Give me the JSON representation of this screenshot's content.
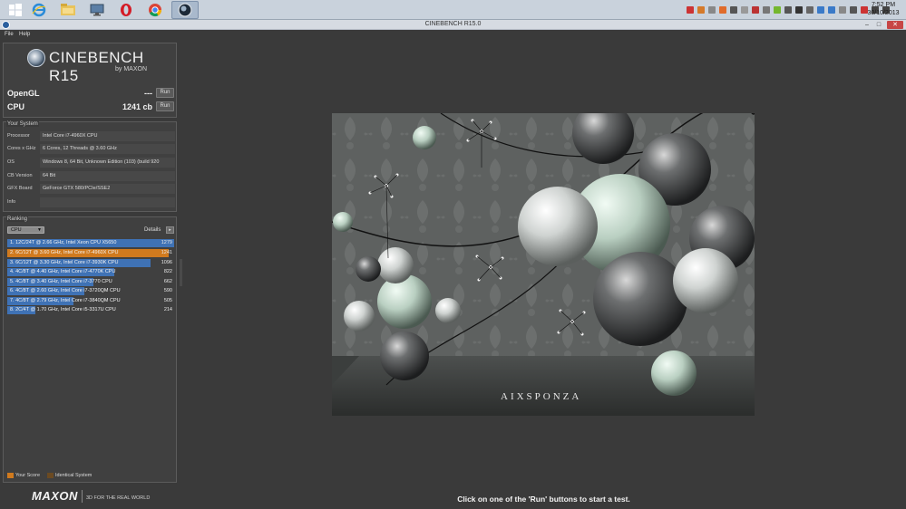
{
  "taskbar": {
    "items": [
      {
        "icon": "windows-start-icon"
      },
      {
        "icon": "internet-explorer-icon"
      },
      {
        "icon": "file-explorer-icon"
      },
      {
        "icon": "computer-icon"
      },
      {
        "icon": "opera-icon"
      },
      {
        "icon": "chrome-icon"
      },
      {
        "icon": "cinebench-icon",
        "active": true
      }
    ],
    "clock_time": "7:52 PM",
    "clock_date": "30/10/2013"
  },
  "window": {
    "title": "CINEBENCH R15.0",
    "minimize": "–",
    "maximize": "□",
    "close": "✕"
  },
  "menu": {
    "items": [
      "File",
      "Help"
    ]
  },
  "header": {
    "logo_text": "CINEBENCH R15",
    "logo_by": "by MAXON"
  },
  "benchmarks": {
    "opengl": {
      "label": "OpenGL",
      "score": "---",
      "run_label": "Run"
    },
    "cpu": {
      "label": "CPU",
      "score": "1241 cb",
      "run_label": "Run"
    }
  },
  "system": {
    "title": "Your System",
    "rows": [
      {
        "label": "Processor",
        "value": "Intel Core i7-4960X CPU"
      },
      {
        "label": "Cores x GHz",
        "value": "6 Cores, 12 Threads @ 3.60 GHz"
      },
      {
        "label": "OS",
        "value": "Windows 8, 64 Bit, Unknown Edition (103) (build 920"
      },
      {
        "label": "CB Version",
        "value": "64 Bit"
      },
      {
        "label": "GFX Board",
        "value": "GeForce GTX 580/PCIe/SSE2"
      },
      {
        "label": "Info",
        "value": ""
      }
    ]
  },
  "ranking": {
    "title": "Ranking",
    "dropdown_value": "CPU",
    "details_label": "Details",
    "details_button": "▸",
    "rows": [
      {
        "text": "1. 12C/24T @ 2.66 GHz, Intel Xeon CPU X5650",
        "score": "1279",
        "fraction": 1.0,
        "highlight": false
      },
      {
        "text": "2. 6C/12T @ 3.60 GHz,  Intel Core i7-4960X CPU",
        "score": "1241",
        "fraction": 0.97,
        "highlight": true
      },
      {
        "text": "3. 6C/12T @ 3.30 GHz,  Intel Core i7-3930K CPU",
        "score": "1096",
        "fraction": 0.857,
        "highlight": false
      },
      {
        "text": "4. 4C/8T @ 4.40 GHz, Intel Core i7-4770K CPU",
        "score": "822",
        "fraction": 0.643,
        "highlight": false
      },
      {
        "text": "5. 4C/8T @ 3.40 GHz,  Intel Core i7-3770 CPU",
        "score": "662",
        "fraction": 0.518,
        "highlight": false
      },
      {
        "text": "6. 4C/8T @ 2.60 GHz, Intel Core i7-3720QM CPU",
        "score": "590",
        "fraction": 0.461,
        "highlight": false
      },
      {
        "text": "7. 4C/8T @ 2.79 GHz,  Intel Core i7-3840QM CPU",
        "score": "505",
        "fraction": 0.395,
        "highlight": false
      },
      {
        "text": "8. 2C/4T @ 1.70 GHz,  Intel Core i5-3317U CPU",
        "score": "214",
        "fraction": 0.167,
        "highlight": false
      }
    ],
    "legend": [
      {
        "label": "Your Score",
        "color": "#d07a1e"
      },
      {
        "label": "Identical System",
        "color": "#6b4a22"
      }
    ]
  },
  "footer": {
    "brand": "MAXON",
    "tagline": "3D FOR THE REAL WORLD",
    "status": "Click on one of the 'Run' buttons to start a test."
  },
  "render": {
    "watermark": "AIXSPONZA"
  },
  "colors": {
    "rank_bar": "#3f72b5",
    "rank_highlight": "#d07a1e",
    "background": "#3a3a3a"
  }
}
